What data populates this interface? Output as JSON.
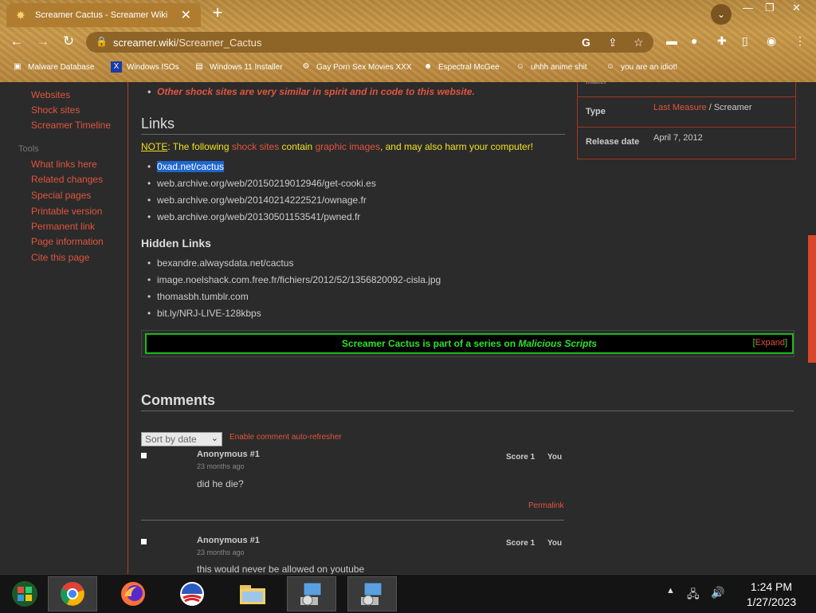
{
  "browser": {
    "tab_title": "Screamer Cactus - Screamer Wiki",
    "url_host": "screamer.wiki",
    "url_path": "/Screamer_Cactus",
    "bookmarks": [
      "Malware Database",
      "Windows ISOs",
      "Windows 11 Installer",
      "Gay Porn Sex Movies XXX",
      "Espectral McGee",
      "uhhh anime shit",
      "you are an idiot!"
    ]
  },
  "sidebar": {
    "links_top": [
      "Websites",
      "Shock sites",
      "Screamer Timeline"
    ],
    "tools_heading": "Tools",
    "tools": [
      "What links here",
      "Related changes",
      "Special pages",
      "Printable version",
      "Permanent link",
      "Page information",
      "Cite this page"
    ]
  },
  "infobox": {
    "cut_label": "maker",
    "type_label": "Type",
    "type_value_link": "Last Measure",
    "type_value_sep": " / ",
    "type_value_text": "Screamer",
    "release_label": "Release date",
    "release_value": "April 7, 2012"
  },
  "article": {
    "top_bullet": "Other shock sites are very similar in spirit and in code to this website.",
    "links_heading": "Links",
    "note": {
      "label": "NOTE",
      "p1": ": The following ",
      "link1": "shock sites",
      "p2": " contain ",
      "link2": "graphic images",
      "p3": ", and may also harm your computer!"
    },
    "links": [
      "0xad.net/cactus",
      "web.archive.org/web/20150219012946/get-cooki.es",
      "web.archive.org/web/20140214222521/ownage.fr",
      "web.archive.org/web/20130501153541/pwned.fr"
    ],
    "hidden_heading": "Hidden Links",
    "hidden_links": [
      "bexandre.alwaysdata.net/cactus",
      "image.noelshack.com.free.fr/fichiers/2012/52/1356820092-cisla.jpg",
      "thomasbh.tumblr.com",
      "bit.ly/NRJ-LIVE-128kbps"
    ],
    "navbox": {
      "text": "Screamer Cactus is part of a series on ",
      "italic": "Malicious Scripts",
      "expand_open": "[",
      "expand": "Expand",
      "expand_close": "]"
    }
  },
  "comments": {
    "heading": "Comments",
    "sort_value": "Sort by date",
    "refresher": "Enable comment auto-refresher",
    "items": [
      {
        "author": "Anonymous #1",
        "time": "23 months ago",
        "score": "Score 1",
        "you": "You",
        "text": "did he die?",
        "permalink": "Permalink"
      },
      {
        "author": "Anonymous #1",
        "time": "23 months ago",
        "score": "Score 1",
        "you": "You",
        "text": "this would never be allowed on youtube"
      }
    ]
  },
  "taskbar": {
    "time": "1:24 PM",
    "date": "1/27/2023"
  },
  "colors": {
    "accent_red": "#e0553f",
    "navbox_green": "#2ee02e",
    "note_yellow": "#f0e020"
  }
}
